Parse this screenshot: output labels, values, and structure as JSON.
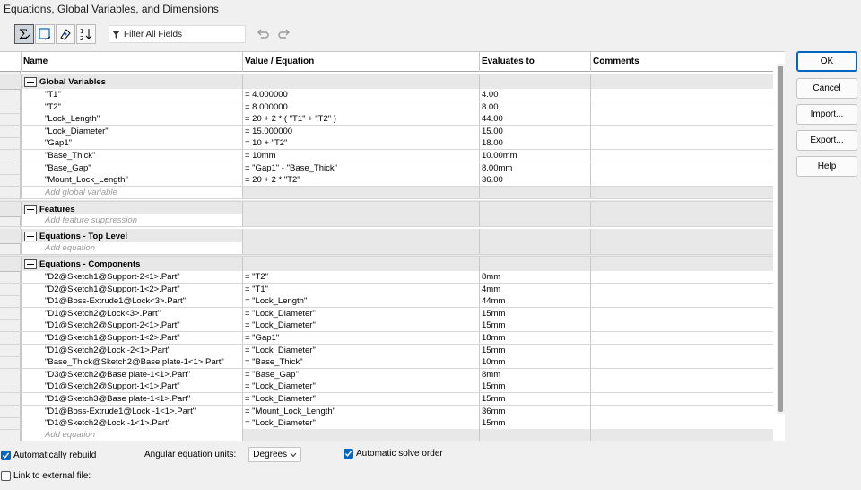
{
  "window": {
    "title": "Equations, Global Variables, and Dimensions"
  },
  "toolbar": {
    "filter_text": "Filter All Fields",
    "buttons": [
      "equation-view-icon",
      "sketch-equation-view-icon",
      "dimension-view-icon",
      "ordered-view-icon"
    ]
  },
  "columns": {
    "name": "Name",
    "value": "Value / Equation",
    "evaluates": "Evaluates to",
    "comments": "Comments"
  },
  "groups": {
    "global": {
      "label": "Global Variables",
      "add": "Add global variable"
    },
    "features": {
      "label": "Features",
      "add": "Add feature suppression"
    },
    "top": {
      "label": "Equations - Top Level",
      "add": "Add equation"
    },
    "components": {
      "label": "Equations - Components",
      "add": "Add equation"
    }
  },
  "global_vars": [
    {
      "name": "\"T1\"",
      "value": "= 4.000000",
      "eval": "4.00"
    },
    {
      "name": "\"T2\"",
      "value": "= 8.000000",
      "eval": "8.00"
    },
    {
      "name": "\"Lock_Length\"",
      "value": "= 20 + 2 * ( \"T1\" + \"T2\" )",
      "eval": "44.00"
    },
    {
      "name": "\"Lock_Diameter\"",
      "value": "= 15.000000",
      "eval": "15.00"
    },
    {
      "name": "\"Gap1\"",
      "value": "= 10 + \"T2\"",
      "eval": "18.00"
    },
    {
      "name": "\"Base_Thick\"",
      "value": "= 10mm",
      "eval": "10.00mm"
    },
    {
      "name": "\"Base_Gap\"",
      "value": "= \"Gap1\" - \"Base_Thick\"",
      "eval": "8.00mm"
    },
    {
      "name": "\"Mount_Lock_Length\"",
      "value": "= 20 + 2 * \"T2\"",
      "eval": "36.00"
    }
  ],
  "components": [
    {
      "name": "\"D2@Sketch1@Support-2<1>.Part\"",
      "value": "= \"T2\"",
      "eval": "8mm"
    },
    {
      "name": "\"D2@Sketch1@Support-1<2>.Part\"",
      "value": "= \"T1\"",
      "eval": "4mm"
    },
    {
      "name": "\"D1@Boss-Extrude1@Lock<3>.Part\"",
      "value": "= \"Lock_Length\"",
      "eval": "44mm"
    },
    {
      "name": "\"D1@Sketch2@Lock<3>.Part\"",
      "value": "= \"Lock_Diameter\"",
      "eval": "15mm"
    },
    {
      "name": "\"D1@Sketch2@Support-2<1>.Part\"",
      "value": "= \"Lock_Diameter\"",
      "eval": "15mm"
    },
    {
      "name": "\"D1@Sketch1@Support-1<2>.Part\"",
      "value": "= \"Gap1\"",
      "eval": "18mm"
    },
    {
      "name": "\"D1@Sketch2@Lock -2<1>.Part\"",
      "value": "= \"Lock_Diameter\"",
      "eval": "15mm"
    },
    {
      "name": "\"Base_Thick@Sketch2@Base plate-1<1>.Part\"",
      "value": "= \"Base_Thick\"",
      "eval": "10mm"
    },
    {
      "name": "\"D3@Sketch2@Base plate-1<1>.Part\"",
      "value": "= \"Base_Gap\"",
      "eval": "8mm"
    },
    {
      "name": "\"D1@Sketch2@Support-1<1>.Part\"",
      "value": "= \"Lock_Diameter\"",
      "eval": "15mm"
    },
    {
      "name": "\"D1@Sketch3@Base plate-1<1>.Part\"",
      "value": "= \"Lock_Diameter\"",
      "eval": "15mm"
    },
    {
      "name": "\"D1@Boss-Extrude1@Lock -1<1>.Part\"",
      "value": "= \"Mount_Lock_Length\"",
      "eval": "36mm"
    },
    {
      "name": "\"D1@Sketch2@Lock -1<1>.Part\"",
      "value": "= \"Lock_Diameter\"",
      "eval": "15mm"
    }
  ],
  "buttons": {
    "ok": "OK",
    "cancel": "Cancel",
    "import": "Import...",
    "export": "Export...",
    "help": "Help"
  },
  "bottom": {
    "auto_rebuild": "Automatically rebuild",
    "angular_label": "Angular equation units:",
    "angular_value": "Degrees",
    "auto_solve": "Automatic solve order",
    "link_external": "Link to external file:"
  }
}
